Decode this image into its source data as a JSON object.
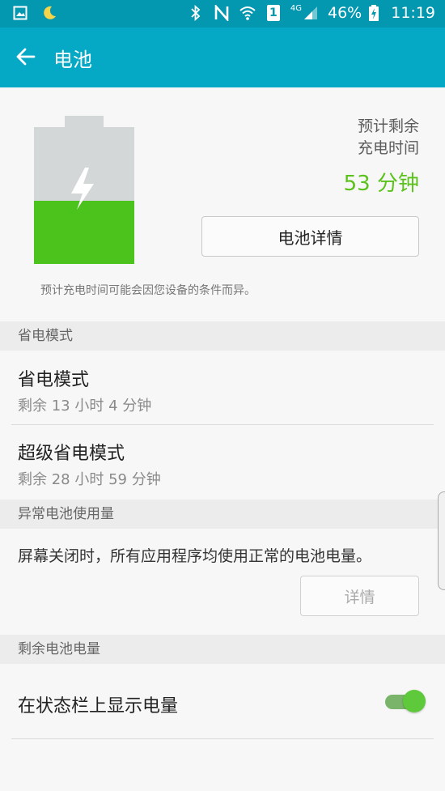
{
  "status_bar": {
    "battery_percent": "46%",
    "time": "11:19",
    "network": "4G",
    "sim_slot": "1",
    "icons": [
      "image-icon",
      "moon-icon",
      "bluetooth-icon",
      "nfc-icon",
      "wifi-icon",
      "sim-icon",
      "signal-icon",
      "battery-charging-icon"
    ]
  },
  "app_bar": {
    "title": "电池",
    "back_icon": "arrow-left-icon"
  },
  "battery_card": {
    "level_percent": 46,
    "eta_label_line1": "预计剩余",
    "eta_label_line2": "充电时间",
    "eta_value": "53 分钟",
    "details_button": "电池详情",
    "note": "预计充电时间可能会因您设备的条件而异。",
    "colors": {
      "fill": "#4cc21c",
      "empty": "#d3d7d8",
      "eta": "#5ac21b"
    }
  },
  "power_saving": {
    "header": "省电模式",
    "items": [
      {
        "title": "省电模式",
        "subtitle": "剩余 13 小时 4 分钟"
      },
      {
        "title": "超级省电模式",
        "subtitle": "剩余 28 小时 59 分钟"
      }
    ]
  },
  "abnormal_usage": {
    "header": "异常电池使用量",
    "message": "屏幕关闭时，所有应用程序均使用正常的电池电量。",
    "details_button": "详情"
  },
  "remaining_battery": {
    "header": "剩余电池电量",
    "toggle_label": "在状态栏上显示电量",
    "toggle_on": true
  },
  "colors": {
    "status_bar": "#0497b0",
    "app_bar": "#05a9c6",
    "accent_green": "#5ac21b"
  }
}
